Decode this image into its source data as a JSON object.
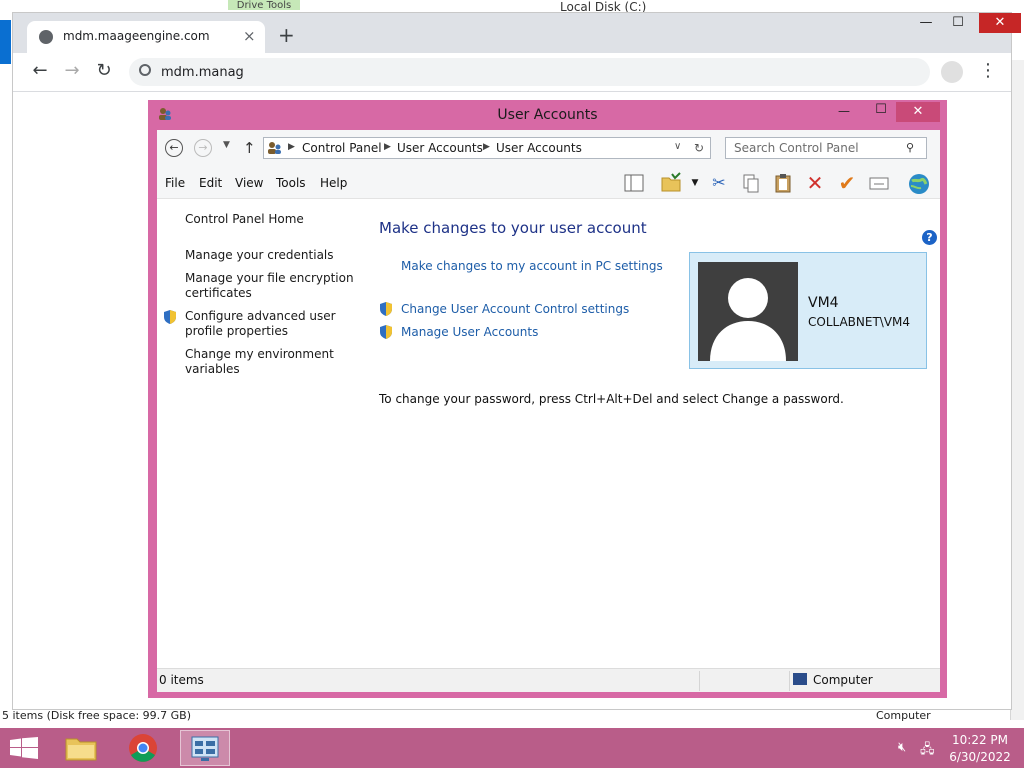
{
  "background": {
    "explorer_title": "Local Disk (C:)",
    "drive_tools": "Drive Tools",
    "status_left": "5 items (Disk free space: 99.7 GB)",
    "status_right": "Computer"
  },
  "browser": {
    "tab_title": "mdm.maageengine.com",
    "address_text": "mdm.manag",
    "icons": [
      "globe-icon",
      "close-icon",
      "plus-icon",
      "back-arrow-icon",
      "forward-arrow-icon",
      "reload-icon",
      "search-icon",
      "profile-icon",
      "menu-dots-icon"
    ]
  },
  "window": {
    "title": "User Accounts",
    "breadcrumb": [
      "Control Panel",
      "User Accounts",
      "User Accounts"
    ],
    "search_placeholder": "Search Control Panel",
    "menu": [
      "File",
      "Edit",
      "View",
      "Tools",
      "Help"
    ]
  },
  "left_pane": {
    "home": "Control Panel Home",
    "credentials": "Manage your credentials",
    "encryption_line1": "Manage your file encryption",
    "encryption_line2": "certificates",
    "advanced_line1": "Configure advanced user",
    "advanced_line2": "profile properties",
    "env_line1": "Change my environment",
    "env_line2": "variables"
  },
  "main": {
    "heading": "Make changes to your user account",
    "pc_settings_link": "Make changes to my account in PC settings",
    "uac_link": "Change User Account Control settings",
    "manage_link": "Manage User Accounts",
    "password_text": "To change your password, press Ctrl+Alt+Del and select Change a password."
  },
  "user": {
    "name": "VM4",
    "domain": "COLLABNET\\VM4"
  },
  "status": {
    "items": "0 items",
    "location": "Computer"
  },
  "taskbar": {
    "time": "10:22 PM",
    "date": "6/30/2022"
  },
  "colors": {
    "window_frame": "#d769a5",
    "taskbar": "#b95d89",
    "link": "#1d5da8",
    "heading": "#1e3287"
  }
}
